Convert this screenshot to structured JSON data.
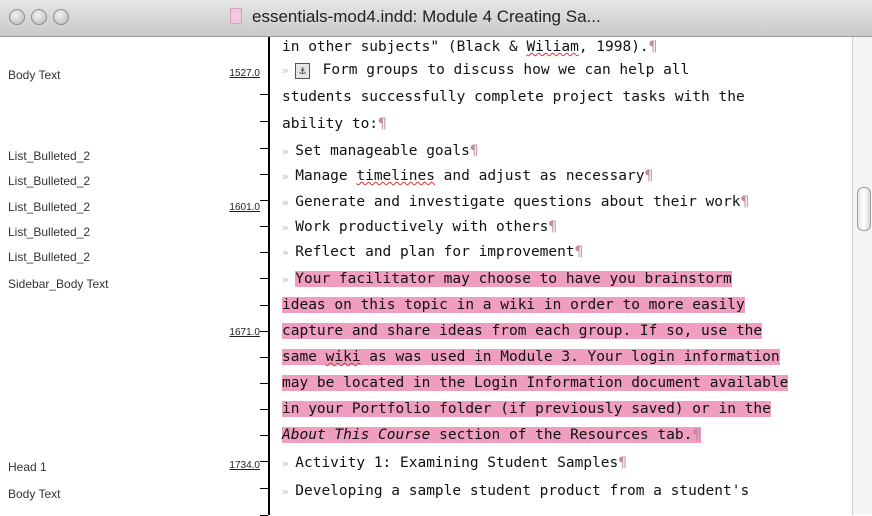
{
  "window": {
    "title": "essentials-mod4.indd: Module 4 Creating Sa..."
  },
  "styles": {
    "items": [
      "Body Text",
      "List_Bulleted_2",
      "List_Bulleted_2",
      "List_Bulleted_2",
      "List_Bulleted_2",
      "List_Bulleted_2",
      "Sidebar_Body Text",
      "Head 1",
      "Body Text"
    ],
    "depths": [
      "1527.0",
      "1601.0",
      "1671.0",
      "1734.0"
    ]
  },
  "text": {
    "lines": [
      {
        "a": "in other subjects\" (Black & ",
        "b": "Wiliam",
        "c": ", 1998).",
        "p": "¶"
      },
      {
        "box": "⚓",
        "a": " Form groups to discuss how we can help all"
      },
      {
        "a": "students successfully complete project tasks with the"
      },
      {
        "a": "ability to:",
        "p": "¶"
      },
      {
        "a": "Set manageable goals",
        "p": "¶"
      },
      {
        "a": "Manage ",
        "b": "timelines",
        "c": " and adjust as necessary",
        "p": "¶"
      },
      {
        "a": "Generate and investigate questions about their work",
        "p": "¶"
      },
      {
        "a": "Work productively with others",
        "p": "¶"
      },
      {
        "a": "Reflect and plan for improvement",
        "p": "¶"
      },
      {
        "a": "Your facilitator may choose to have you brainstorm"
      },
      {
        "a": "ideas on this topic in a wiki in order to more easily"
      },
      {
        "a": "capture and share ideas from each group. If so, use the"
      },
      {
        "a": "same ",
        "b": "wiki",
        "c": " as was used in Module 3. Your login information"
      },
      {
        "a": "may be located in the Login Information document available"
      },
      {
        "a": "in your Portfolio folder (if previously saved) or in the"
      },
      {
        "i": "About This Course",
        "c": " section of the Resources tab.",
        "p": "¶"
      },
      {
        "a": "Activity 1: Examining Student Samples",
        "p": "¶"
      },
      {
        "a": "Developing a sample student product from a student's"
      }
    ]
  },
  "colors": {
    "highlight": "#ef9ec0"
  }
}
